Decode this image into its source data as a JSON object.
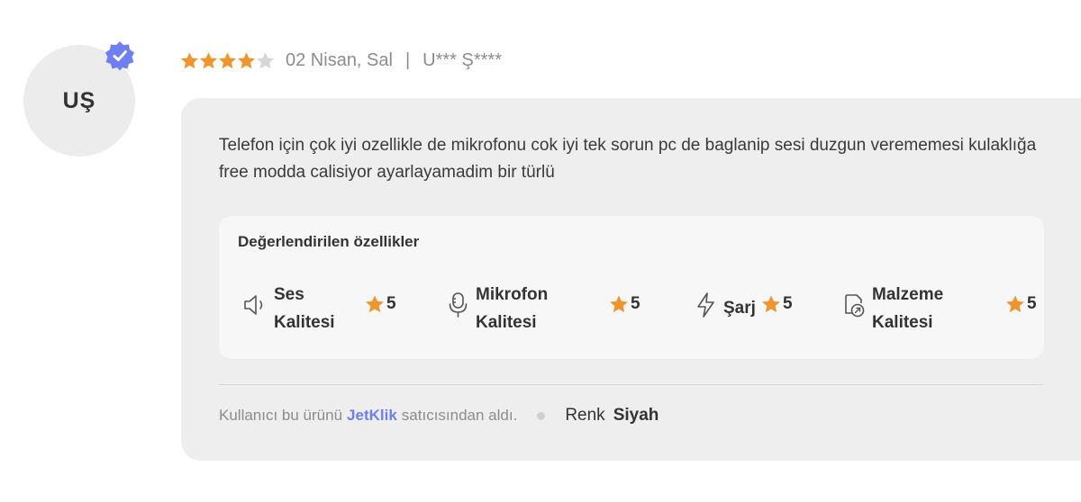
{
  "avatar": {
    "initials": "UŞ",
    "verified_icon": "verified-badge-icon"
  },
  "review": {
    "rating": 4,
    "max_rating": 5,
    "date": "02 Nisan, Sal",
    "separator": "|",
    "author": "U*** Ş****",
    "comment": "Telefon için çok iyi ozellikle de mikrofonu cok iyi tek sorun pc de baglanip sesi duzgun verememesi kulaklığa free modda calisiyor ayarlayamadim bir türlü"
  },
  "features": {
    "title": "Değerlendirilen özellikler",
    "items": [
      {
        "label_line1": "Ses",
        "label_line2": "Kalitesi",
        "rating": "5",
        "icon": "speaker-icon"
      },
      {
        "label_line1": "Mikrofon",
        "label_line2": "Kalitesi",
        "rating": "5",
        "icon": "microphone-icon"
      },
      {
        "label_line1": "Şarj",
        "label_line2": "",
        "rating": "5",
        "icon": "lightning-icon"
      },
      {
        "label_line1": "Malzeme",
        "label_line2": "Kalitesi",
        "rating": "5",
        "icon": "material-icon"
      }
    ]
  },
  "footer": {
    "prefix": "Kullanıcı bu ürünü",
    "seller": "JetKlik",
    "suffix": "satıcısından aldı.",
    "color_label": "Renk",
    "color_value": "Siyah"
  },
  "colors": {
    "star_filled": "#F0942E",
    "star_empty": "#D6D6D6",
    "verified": "#6F7EF0",
    "seller_link": "#6F7EF0",
    "card_bg": "#EEEEEE"
  }
}
